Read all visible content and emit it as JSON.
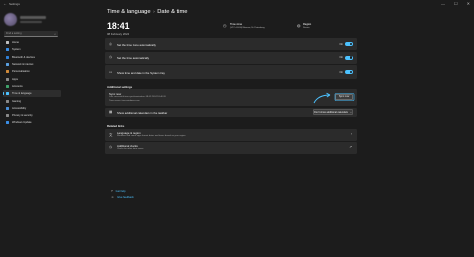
{
  "window": {
    "title": "Settings",
    "back_glyph": "←",
    "min": "—",
    "max": "☐",
    "close": "✕"
  },
  "sidebar": {
    "search_placeholder": "Find a setting",
    "items": [
      {
        "label": "Home",
        "color": "#c0c0c0"
      },
      {
        "label": "System",
        "color": "#3a8ee6"
      },
      {
        "label": "Bluetooth & devices",
        "color": "#2f7fd6"
      },
      {
        "label": "Network & internet",
        "color": "#5aa0e0"
      },
      {
        "label": "Personalisation",
        "color": "#d08a3a"
      },
      {
        "label": "Apps",
        "color": "#8a8a8a"
      },
      {
        "label": "Accounts",
        "color": "#3fa36b"
      },
      {
        "label": "Time & language",
        "color": "#4cc2ff",
        "active": true
      },
      {
        "label": "Gaming",
        "color": "#8a8a8a"
      },
      {
        "label": "Accessibility",
        "color": "#4a90d9"
      },
      {
        "label": "Privacy & security",
        "color": "#8a8a8a"
      },
      {
        "label": "Windows Update",
        "color": "#3a8ee6"
      }
    ]
  },
  "header": {
    "section": "Time & language",
    "page": "Date & time",
    "separator": "›"
  },
  "clock": {
    "time": "18:41",
    "date": "08 February 2024"
  },
  "timezone": {
    "label": "Time zone",
    "value": "(UTC+03:00) Moscow, St. Petersburg"
  },
  "region": {
    "label": "Region",
    "value": "Russia"
  },
  "toggles": [
    {
      "label": "Set the time zone automatically",
      "state": "On"
    },
    {
      "label": "Set the time automatically",
      "state": "On"
    },
    {
      "label": "Show time and date in the System tray",
      "state": "On"
    }
  ],
  "additional": {
    "heading": "Additional settings",
    "sync_title": "Sync now",
    "sync_last": "Last successful time synchronisation: 08.02.2024 18:40:20",
    "sync_server": "Time server: time.windows.com",
    "sync_button": "Sync now",
    "calendars_label": "Show additional calendars in the taskbar",
    "calendars_value": "Don't show additional calendars"
  },
  "related": {
    "heading": "Related links",
    "items": [
      {
        "title": "Language & region",
        "subtitle": "Windows and some apps format dates and times based on your region"
      },
      {
        "title": "Additional clocks",
        "subtitle": "Clocks for other time zones"
      }
    ]
  },
  "footer_links": [
    {
      "label": "Get help"
    },
    {
      "label": "Give feedback"
    }
  ],
  "accent_color": "#4cc2ff"
}
